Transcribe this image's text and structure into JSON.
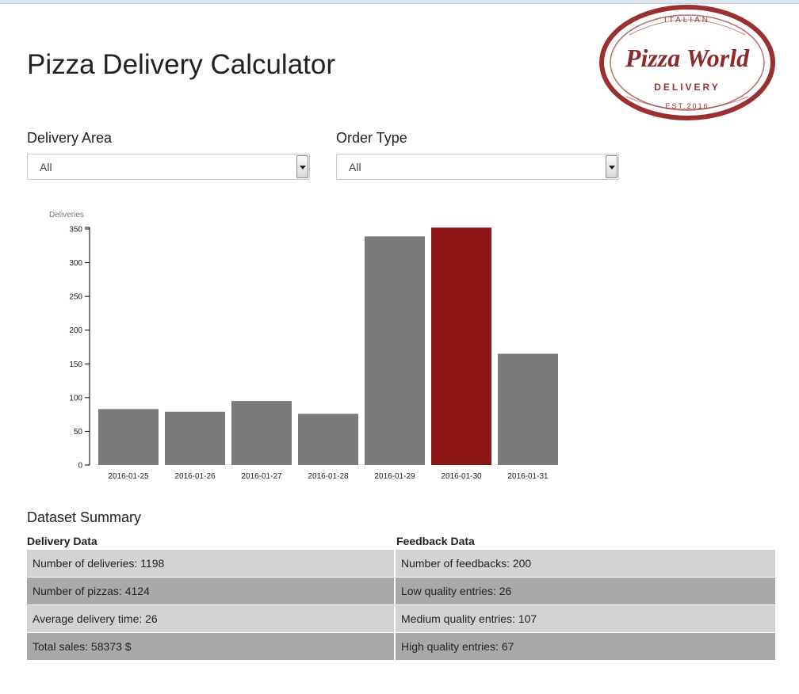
{
  "page": {
    "title": "Pizza Delivery Calculator"
  },
  "logo": {
    "top": "ITALIAN",
    "script": "Pizza World",
    "middle": "DELIVERY",
    "bottom": "EST.2016"
  },
  "filters": {
    "area": {
      "label": "Delivery Area",
      "value": "All"
    },
    "order": {
      "label": "Order Type",
      "value": "All"
    }
  },
  "colors": {
    "bar": "#7a7a7a",
    "highlight": "#8b1515",
    "logo": "#9b3030"
  },
  "chart_data": {
    "type": "bar",
    "ylabel": "Deliveries",
    "categories": [
      "2016-01-25",
      "2016-01-26",
      "2016-01-27",
      "2016-01-28",
      "2016-01-29",
      "2016-01-30",
      "2016-01-31"
    ],
    "values": [
      83,
      79,
      95,
      76,
      339,
      352,
      165
    ],
    "highlight_index": 5,
    "ylim": [
      0,
      350
    ],
    "yticks": [
      0,
      50,
      100,
      150,
      200,
      250,
      300,
      350
    ]
  },
  "summary": {
    "title": "Dataset Summary",
    "delivery_header": "Delivery Data",
    "feedback_header": "Feedback Data",
    "rows": [
      {
        "left": "Number of deliveries: 1198",
        "right": "Number of feedbacks: 200"
      },
      {
        "left": "Number of pizzas: 4124",
        "right": "Low quality entries: 26"
      },
      {
        "left": "Average delivery time: 26",
        "right": "Medium quality entries: 107"
      },
      {
        "left": "Total sales: 58373 $",
        "right": "High quality entries: 67"
      }
    ]
  }
}
